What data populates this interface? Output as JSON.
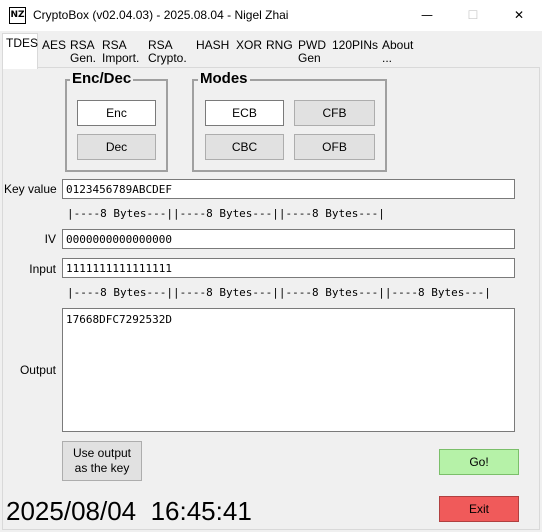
{
  "window": {
    "title": "CryptoBox (v02.04.03) - 2025.08.04 - Nigel Zhai",
    "icon_text": "NZ",
    "minimize": "—",
    "maximize": "☐",
    "close": "✕"
  },
  "tabs": [
    {
      "label": "TDES"
    },
    {
      "label": "AES"
    },
    {
      "label": "RSA\nGen."
    },
    {
      "label": "RSA\nImport."
    },
    {
      "label": "RSA\nCrypto."
    },
    {
      "label": "HASH"
    },
    {
      "label": "XOR"
    },
    {
      "label": "RNG"
    },
    {
      "label": "PWD\nGen"
    },
    {
      "label": "120PINs"
    },
    {
      "label": "About\n..."
    }
  ],
  "enc_dec": {
    "title": "Enc/Dec",
    "enc": "Enc",
    "dec": "Dec",
    "selected": "Enc"
  },
  "modes": {
    "title": "Modes",
    "ecb": "ECB",
    "cfb": "CFB",
    "cbc": "CBC",
    "ofb": "OFB",
    "selected": "ECB"
  },
  "key": {
    "label": "Key value",
    "value": "0123456789ABCDEF",
    "ruler": "|----8 Bytes---||----8 Bytes---||----8 Bytes---|"
  },
  "iv": {
    "label": "IV",
    "value": "0000000000000000"
  },
  "input": {
    "label": "Input",
    "value": "1111111111111111",
    "ruler": "|----8 Bytes---||----8 Bytes---||----8 Bytes---||----8 Bytes---|"
  },
  "output": {
    "label": "Output",
    "value": "17668DFC7292532D"
  },
  "buttons": {
    "use_output": "Use output\nas the key",
    "go": "Go!",
    "exit": "Exit",
    "go_color": "#b6f2a8",
    "exit_color": "#f05a5a"
  },
  "datetime": "2025/08/04  16:45:41"
}
